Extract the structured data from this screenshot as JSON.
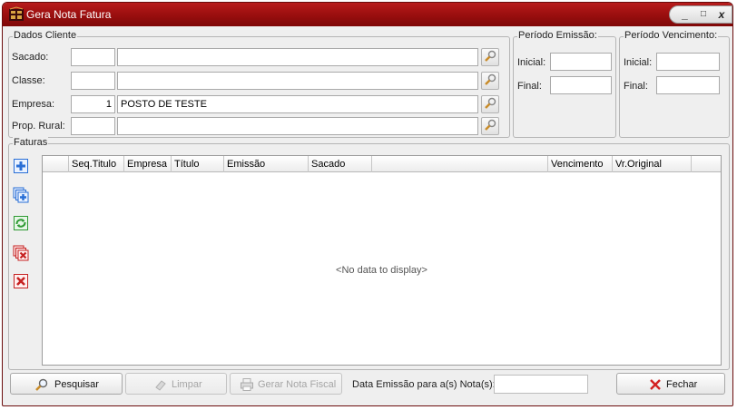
{
  "window": {
    "title": "Gera Nota Fatura",
    "minimize": "_",
    "restore": "□",
    "close": "x"
  },
  "dados_cliente": {
    "title": "Dados Cliente",
    "sacado": {
      "label": "Sacado:",
      "code": "",
      "name": ""
    },
    "classe": {
      "label": "Classe:",
      "code": "",
      "name": ""
    },
    "empresa": {
      "label": "Empresa:",
      "code": "1",
      "name": "POSTO DE TESTE"
    },
    "prop_rural": {
      "label": "Prop. Rural:",
      "code": "",
      "name": ""
    }
  },
  "periodo_emissao": {
    "title": "Período Emissão:",
    "inicial_label": "Inicial:",
    "inicial": "",
    "final_label": "Final:",
    "final": ""
  },
  "periodo_vencimento": {
    "title": "Período Vencimento:",
    "inicial_label": "Inicial:",
    "inicial": "",
    "final_label": "Final:",
    "final": ""
  },
  "faturas": {
    "title": "Faturas",
    "columns": [
      "Seq.Titulo",
      "Empresa",
      "Título",
      "Emissão",
      "Sacado",
      "",
      "Vencimento",
      "Vr.Original"
    ],
    "empty_text": "<No data to display>"
  },
  "footer": {
    "pesquisar": "Pesquisar",
    "limpar": "Limpar",
    "gerar": "Gerar Nota Fiscal",
    "data_emissao_label": "Data Emissão para a(s) Nota(s):",
    "data_emissao_value": "",
    "fechar": "Fechar"
  },
  "colors": {
    "titlebar": "#9e1010",
    "accent_close": "#d32020",
    "side_icon_blue": "#2a6fd6",
    "side_icon_green": "#2e9a33"
  }
}
